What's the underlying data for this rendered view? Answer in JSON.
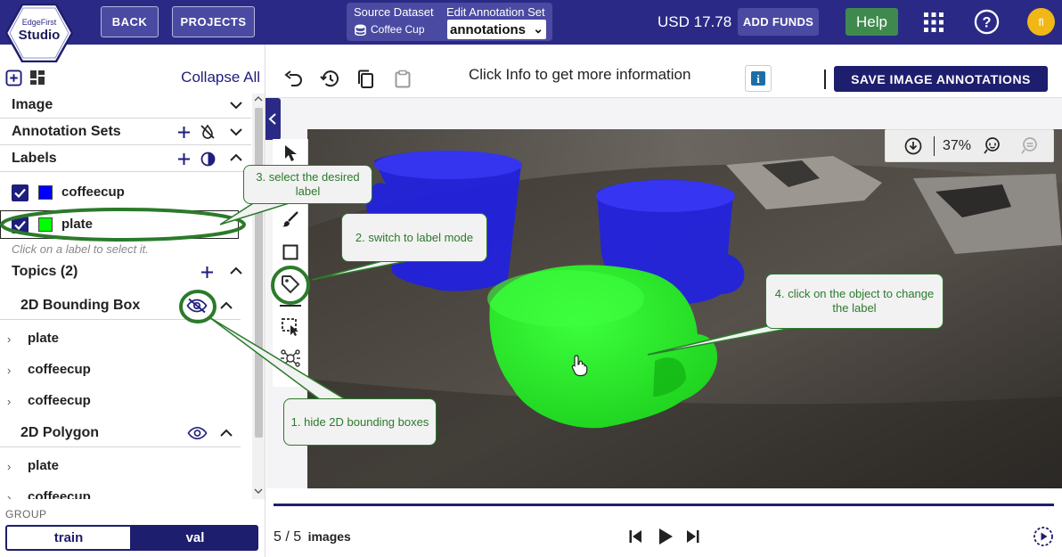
{
  "app": {
    "logo_top": "EdgeFirst",
    "logo_bottom": "Studio"
  },
  "topbar": {
    "back_label": "BACK",
    "projects_label": "PROJECTS",
    "source_dataset_label": "Source Dataset",
    "source_dataset_value": "Coffee Cup",
    "annotation_set_label": "Edit Annotation Set",
    "annotation_set_value": "annotations",
    "balance": "USD 17.78",
    "add_funds_label": "ADD FUNDS",
    "help_label": "Help",
    "avatar_initials": "fl",
    "brand_color": "#2a2a86"
  },
  "sidebar": {
    "collapse_all": "Collapse All",
    "sections": {
      "image": "Image",
      "annotation_sets": "Annotation Sets",
      "labels": "Labels"
    },
    "labels": [
      {
        "name": "coffeecup",
        "color": "#0000ff",
        "checked": true
      },
      {
        "name": "plate",
        "color": "#00ff00",
        "checked": true
      }
    ],
    "label_hint": "Click on a label to select it.",
    "topics_title": "Topics (2)",
    "topics": [
      {
        "title": "2D Bounding Box",
        "items": [
          "plate",
          "coffeecup",
          "coffeecup"
        ]
      },
      {
        "title": "2D Polygon",
        "items": [
          "plate",
          "coffeecup"
        ]
      }
    ],
    "group_label": "GROUP",
    "group_options": [
      "train",
      "val"
    ],
    "group_selected": "val"
  },
  "toolbar": {
    "info_text": "Click Info to get more information",
    "save_label": "SAVE IMAGE ANNOTATIONS"
  },
  "canvas": {
    "zoom": "37%"
  },
  "callouts": {
    "c1": "1. hide 2D bounding boxes",
    "c2": "2. switch to label mode",
    "c3": "3. select the desired label",
    "c4": "4. click on the object to change the label"
  },
  "footer": {
    "counter": "5 / 5",
    "counter_unit": "images"
  }
}
